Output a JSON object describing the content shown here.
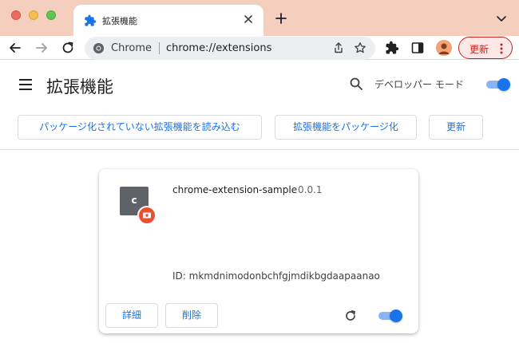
{
  "tab": {
    "title": "拡張機能"
  },
  "omnibox": {
    "label": "Chrome",
    "url": "chrome://extensions"
  },
  "toolbar": {
    "update_label": "更新"
  },
  "header": {
    "title": "拡張機能",
    "dev_mode_label": "デベロッパー モード",
    "dev_mode_on": true
  },
  "actions": {
    "load_unpacked": "パッケージ化されていない拡張機能を読み込む",
    "pack": "拡張機能をパッケージ化",
    "update": "更新"
  },
  "extension": {
    "icon_letter": "c",
    "name": "chrome-extension-sample",
    "version": "0.0.1",
    "id_text": "ID: mkmdnimodonbchfgjmdikbgdaapaanao",
    "details_label": "詳細",
    "remove_label": "削除",
    "enabled": true
  },
  "colors": {
    "tabstrip": "#f4cfbd",
    "accent": "#1a73e8",
    "update_red": "#c5221f",
    "badge": "#e8502f"
  },
  "icons": [
    "puzzle-icon",
    "close-icon",
    "plus-icon",
    "chevron-down-icon",
    "back-arrow-icon",
    "forward-arrow-icon",
    "reload-icon",
    "chrome-logo-icon",
    "share-icon",
    "star-icon",
    "extensions-icon",
    "side-panel-icon",
    "profile-avatar-icon",
    "more-vertical-icon",
    "menu-icon",
    "search-icon"
  ]
}
